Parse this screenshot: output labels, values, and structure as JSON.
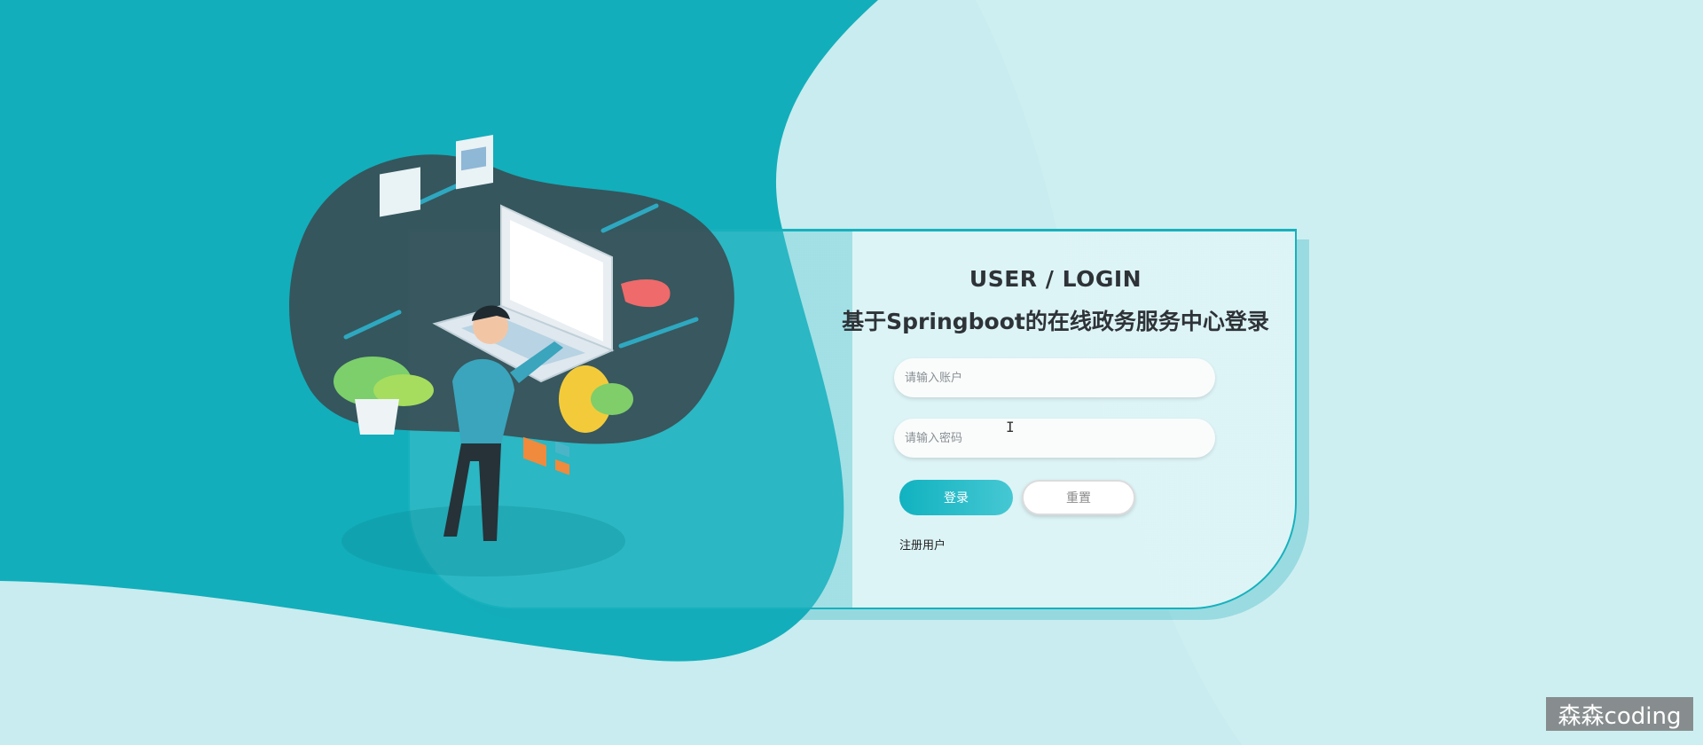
{
  "login": {
    "title_en": "USER / LOGIN",
    "title_cn": "基于Springboot的在线政务服务中心登录",
    "account_placeholder": "请输入账户",
    "password_placeholder": "请输入密码",
    "login_label": "登录",
    "reset_label": "重置",
    "register_label": "注册用户"
  },
  "watermark": "森森coding",
  "colors": {
    "accent": "#14b3c0",
    "background_light": "#c8ecef",
    "background_dark": "#12aebb",
    "text": "#2e3338"
  }
}
